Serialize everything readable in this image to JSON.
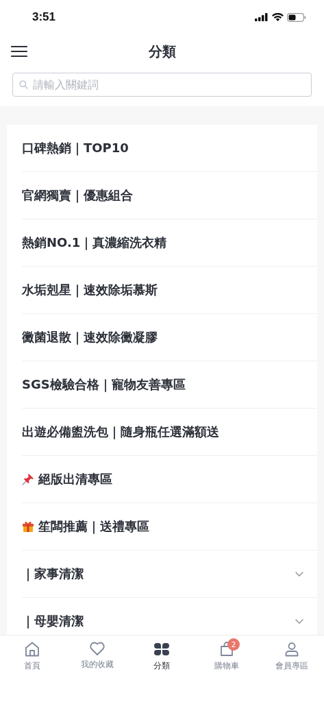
{
  "status_bar": {
    "time": "3:51"
  },
  "header": {
    "title": "分類"
  },
  "search": {
    "placeholder": "請輸入關鍵詞"
  },
  "categories": [
    {
      "label": "口碑熱銷｜TOP10",
      "kind": "link"
    },
    {
      "label": "官網獨賣｜優惠組合",
      "kind": "link"
    },
    {
      "label": "熱銷NO.1｜真濃縮洗衣精",
      "kind": "link"
    },
    {
      "label": "水垢剋星｜速效除垢慕斯",
      "kind": "link"
    },
    {
      "label": "黴菌退散｜速效除黴凝膠",
      "kind": "link"
    },
    {
      "label": "SGS檢驗合格｜寵物友善專區",
      "kind": "link"
    },
    {
      "label": "出遊必備盥洗包｜隨身瓶任選滿額送",
      "kind": "link"
    },
    {
      "label": "絕版出清專區",
      "kind": "pinned"
    },
    {
      "label": "笙闆推薦｜送禮專區",
      "kind": "gift"
    },
    {
      "label": "｜家事清潔",
      "kind": "group"
    },
    {
      "label": "｜母嬰清潔",
      "kind": "group"
    }
  ],
  "nav": [
    {
      "label": "首頁",
      "selected": false
    },
    {
      "label": "我的收藏",
      "selected": false
    },
    {
      "label": "分類",
      "selected": true
    },
    {
      "label": "購物車",
      "selected": false,
      "badge": "2"
    },
    {
      "label": "會員專區",
      "selected": false
    }
  ]
}
